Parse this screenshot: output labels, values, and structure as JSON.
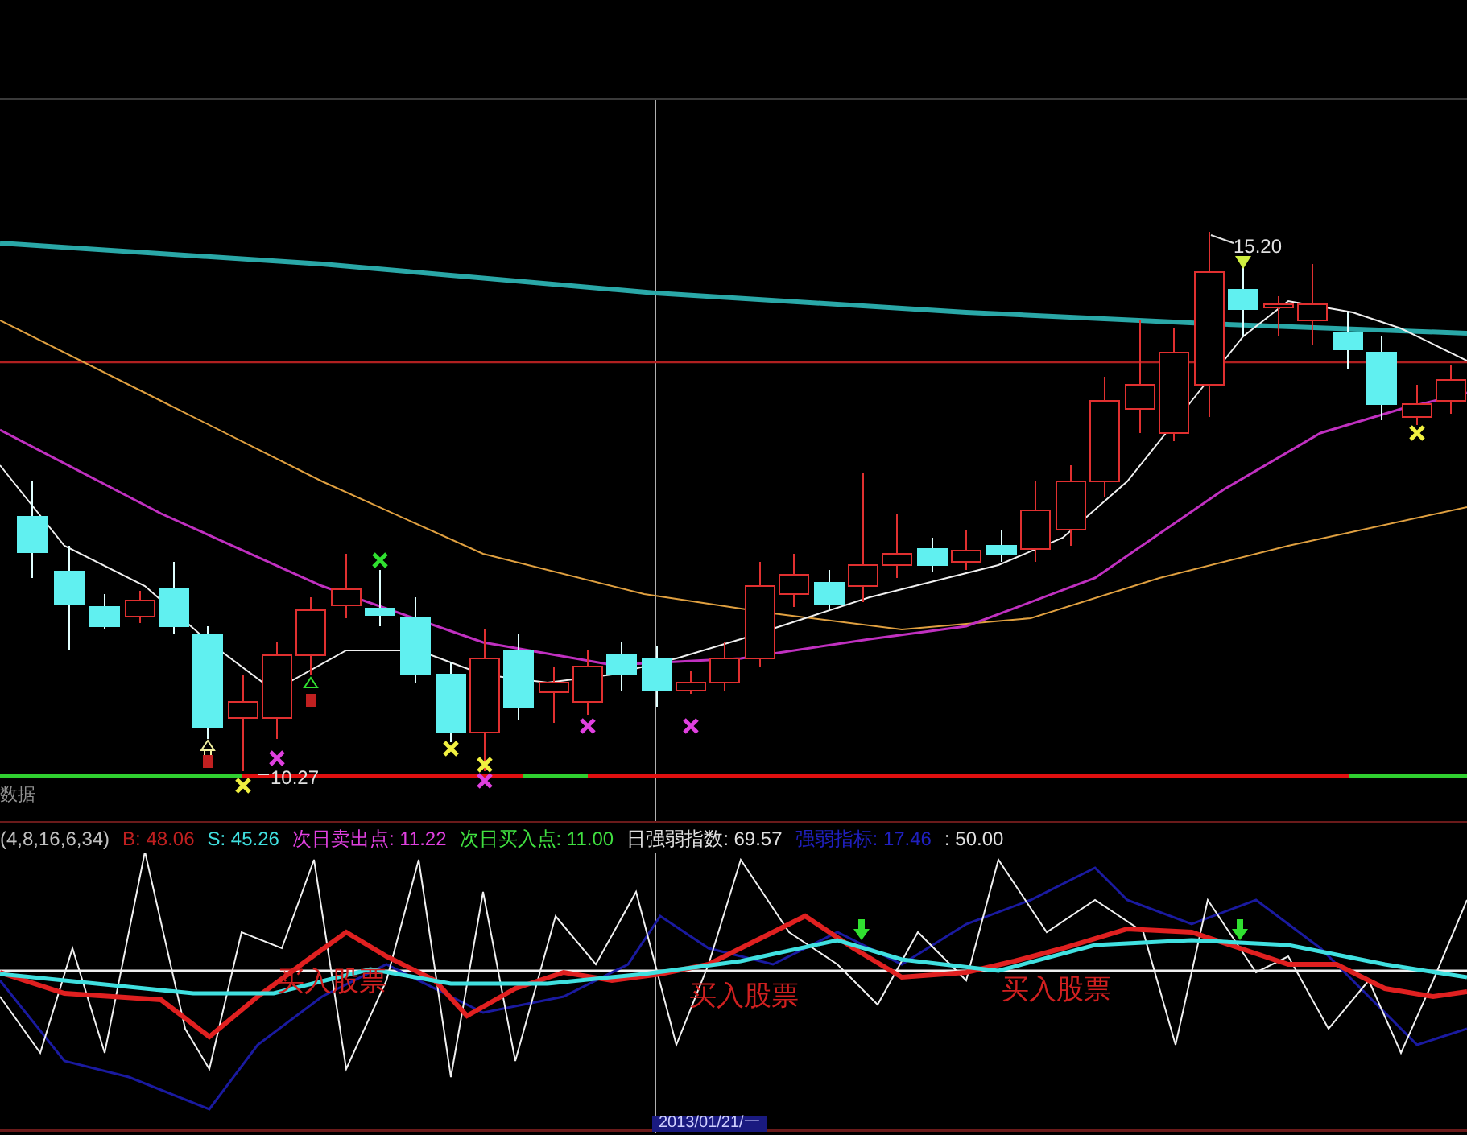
{
  "price_chart": {
    "high_label": "15.20",
    "low_label": "10.27",
    "panel_label": "数据"
  },
  "indicator_legend": [
    {
      "text": "(4,8,16,6,34)",
      "color": "#c0c0c0"
    },
    {
      "text": "B: 48.06",
      "color": "#c02020"
    },
    {
      "text": "S: 45.26",
      "color": "#40e0e0"
    },
    {
      "text": "次日卖出点: 11.22",
      "color": "#e040e0"
    },
    {
      "text": "次日买入点: 11.00",
      "color": "#40e040"
    },
    {
      "text": "日强弱指数: 69.57",
      "color": "#e0e0e0"
    },
    {
      "text": "强弱指标: 17.46",
      "color": "#2020c0"
    },
    {
      "text": ": 50.00",
      "color": "#e0e0e0"
    }
  ],
  "indicator_signals": [
    "买入股票",
    "买入股票",
    "买入股票"
  ],
  "date_label": "2013/01/21/一"
}
